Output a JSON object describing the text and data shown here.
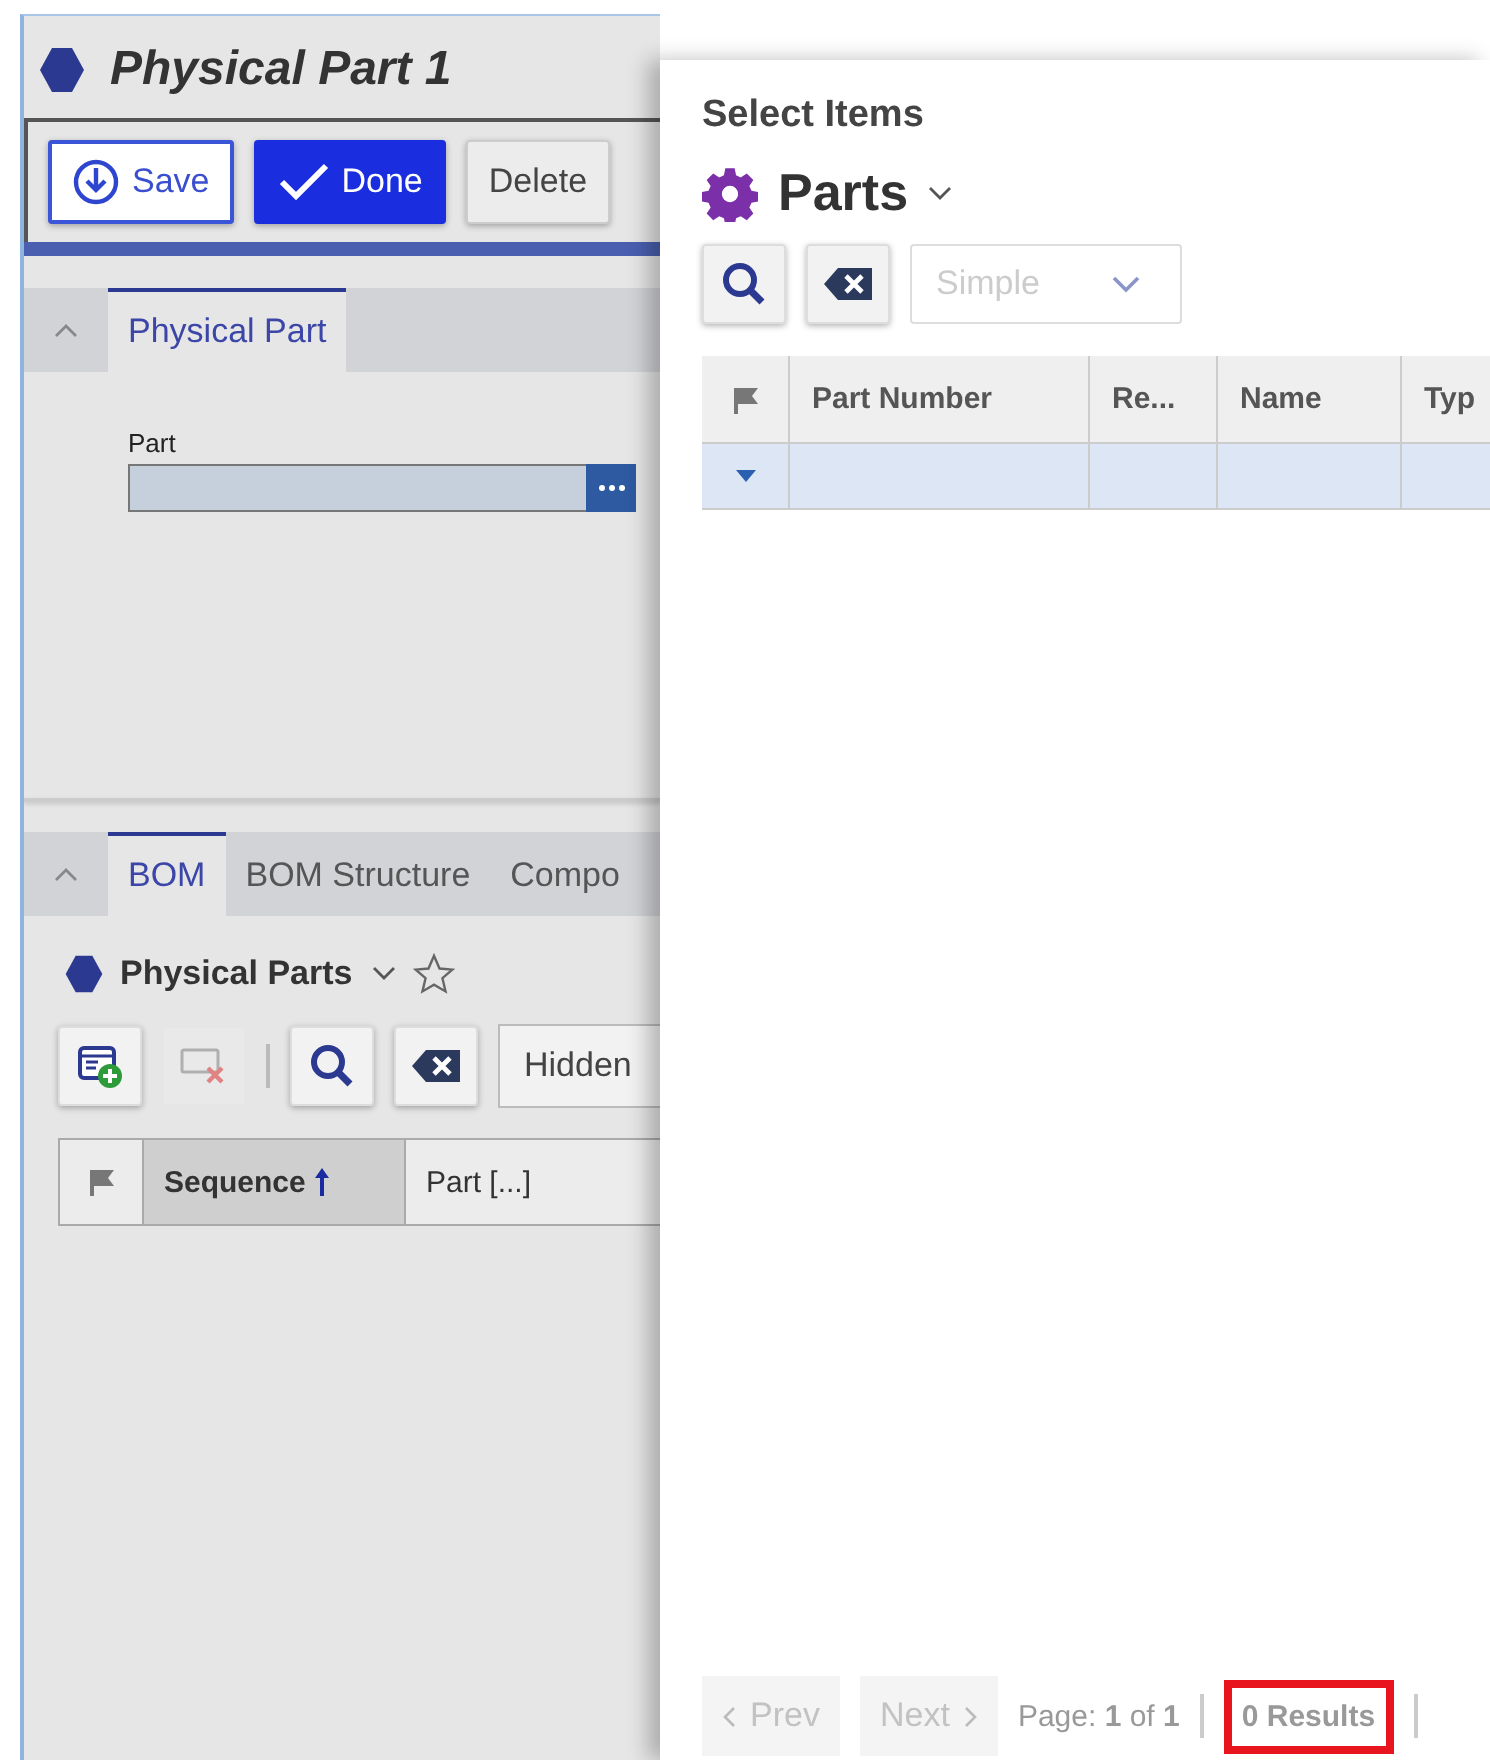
{
  "record": {
    "title": "Physical Part 1",
    "toolbar": [
      {
        "kind": "save",
        "label": "Save"
      },
      {
        "kind": "done",
        "label": "Done"
      },
      {
        "kind": "plain",
        "label": "Delete"
      }
    ],
    "form_section": {
      "tabs": [
        {
          "label": "Physical Part",
          "selected": true
        }
      ],
      "fields": [
        {
          "label": "Part"
        }
      ]
    },
    "bom_section": {
      "tabs": [
        {
          "label": "BOM",
          "selected": true
        },
        {
          "label": "BOM Structure",
          "selected": false
        },
        {
          "label": "Compo",
          "selected": false
        }
      ],
      "view_title": "Physical Parts",
      "toolbar": [
        {
          "kind": "add",
          "disabled": false
        },
        {
          "kind": "remove",
          "disabled": true
        },
        {
          "kind": "search",
          "disabled": false
        },
        {
          "kind": "clear",
          "disabled": false
        }
      ],
      "filter": {
        "value": "Hidden"
      },
      "columns": [
        {
          "label": "Sequence",
          "sorted": true
        },
        {
          "label": "Part [...]",
          "sorted": false
        }
      ]
    }
  },
  "dialog": {
    "title": "Select Items",
    "item_type": "Parts",
    "filter": {
      "value": "Simple",
      "disabled": true
    },
    "columns": [
      "Part Number",
      "Re...",
      "Name",
      "Typ"
    ],
    "pager": {
      "prev": {
        "label": "Prev",
        "disabled": true
      },
      "next": {
        "label": "Next",
        "disabled": true
      },
      "page": "Page: **1** of **1**",
      "results": "0 Results",
      "results_highlighted": true
    }
  }
}
